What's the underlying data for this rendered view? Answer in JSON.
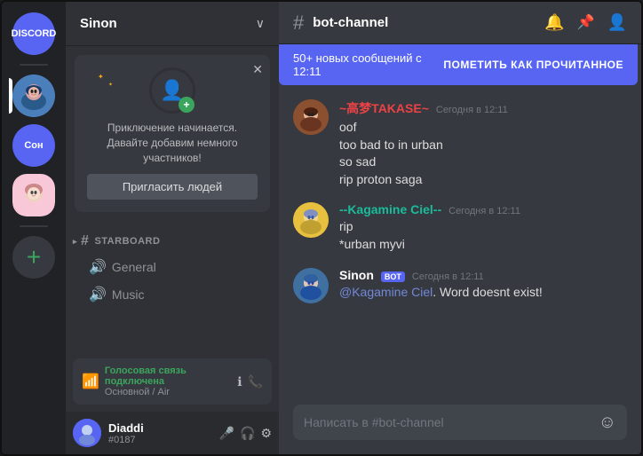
{
  "app": {
    "title": "Discord"
  },
  "server_sidebar": {
    "discord_logo": "⊕",
    "servers": [
      {
        "id": "server-1",
        "label": "S",
        "type": "avatar",
        "active": true
      },
      {
        "id": "server-2",
        "label": "Сон",
        "type": "text"
      },
      {
        "id": "server-3",
        "label": "🌸",
        "type": "avatar2"
      }
    ],
    "add_server_label": "+"
  },
  "channel_sidebar": {
    "server_name": "Sinon",
    "welcome_card": {
      "text": "Приключение начинается. Давайте добавим немного участников!",
      "invite_button_label": "Пригласить людей"
    },
    "categories": [
      {
        "id": "text-channels",
        "label": "starboard",
        "type": "channel",
        "hash": "#"
      }
    ],
    "channels": [
      {
        "id": "general",
        "label": "General",
        "type": "voice",
        "icon": "🔊"
      },
      {
        "id": "music",
        "label": "Music",
        "type": "voice",
        "icon": "🔊"
      }
    ],
    "voice_status": {
      "connected_label": "Голосовая связь подключена",
      "channel_name": "Основной / Air"
    },
    "user": {
      "name": "Diaddi",
      "tag": "#0187"
    }
  },
  "chat": {
    "channel_name": "bot-channel",
    "unread_banner": {
      "text": "50+ новых сообщений с 12:11",
      "button_label": "ПОМЕТИТЬ КАК ПРОЧИТАННОЕ"
    },
    "messages": [
      {
        "id": "msg-1",
        "author": "~高梦TAKASE~",
        "author_color": "red",
        "timestamp": "Сегодня в 12:11",
        "lines": [
          "oof",
          "too bad to in urban",
          "so sad",
          "rip proton saga"
        ],
        "avatar_type": "takase"
      },
      {
        "id": "msg-2",
        "author": "--Kagamine Ciel--",
        "author_color": "teal",
        "timestamp": "Сегодня в 12:11",
        "lines": [
          "rip",
          "*urban myvi"
        ],
        "avatar_type": "kagamine"
      },
      {
        "id": "msg-3",
        "author": "Sinon",
        "author_color": "white",
        "is_bot": true,
        "bot_label": "BOT",
        "timestamp": "Сегодня в 12:11",
        "lines": [
          "@Kagamine Ciel. Word doesnt exist!"
        ],
        "mention": "@Kagamine Ciel",
        "avatar_type": "sinon"
      }
    ],
    "input_placeholder": "Написать в #bot-channel"
  }
}
